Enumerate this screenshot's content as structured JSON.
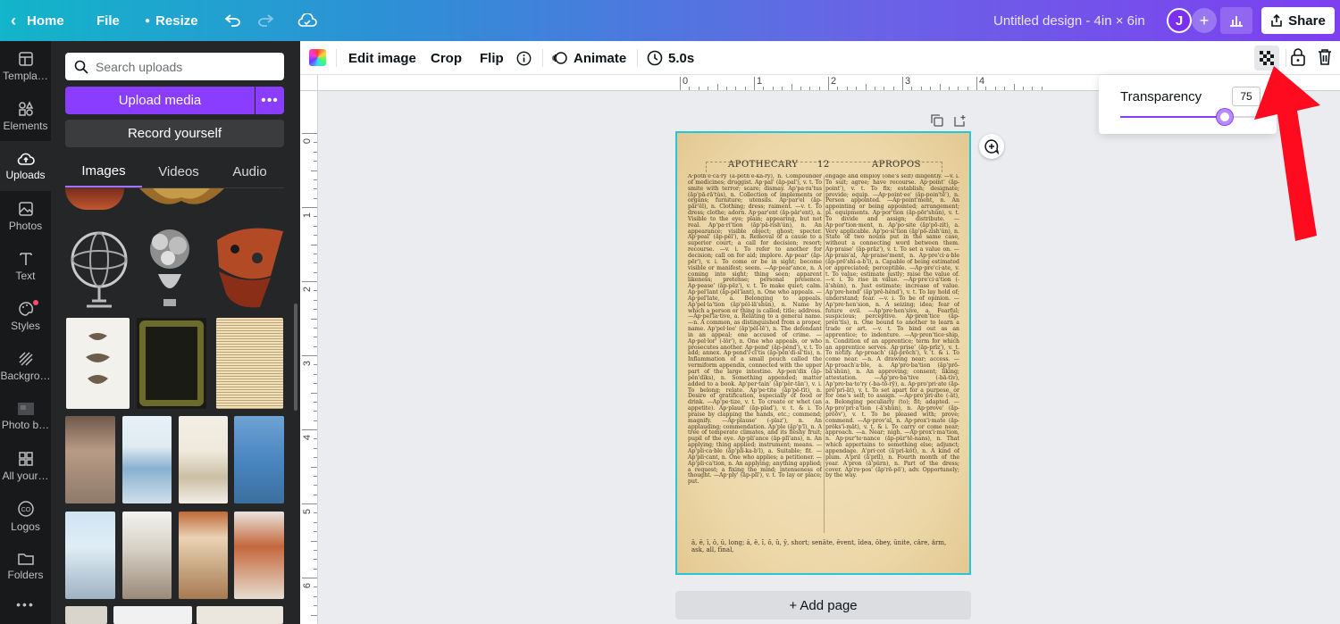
{
  "topbar": {
    "home": "Home",
    "file": "File",
    "resize": "Resize",
    "title": "Untitled design - 4in × 6in",
    "avatar_initial": "J",
    "share": "Share"
  },
  "rail": [
    {
      "label": "Templa…",
      "icon": "template-icon"
    },
    {
      "label": "Elements",
      "icon": "elements-icon"
    },
    {
      "label": "Uploads",
      "icon": "upload-cloud-icon",
      "active": true
    },
    {
      "label": "Photos",
      "icon": "photos-icon"
    },
    {
      "label": "Text",
      "icon": "text-icon"
    },
    {
      "label": "Styles",
      "icon": "styles-icon"
    },
    {
      "label": "Backgro…",
      "icon": "background-icon"
    },
    {
      "label": "Photo b…",
      "icon": "photo-background-icon"
    },
    {
      "label": "All your…",
      "icon": "all-your-designs-icon"
    },
    {
      "label": "Logos",
      "icon": "logos-icon"
    },
    {
      "label": "Folders",
      "icon": "folder-icon"
    }
  ],
  "panel": {
    "search_placeholder": "Search uploads",
    "upload_media": "Upload media",
    "more": "•••",
    "record": "Record yourself",
    "tabs": [
      "Images",
      "Videos",
      "Audio"
    ]
  },
  "context_toolbar": {
    "edit_image": "Edit image",
    "crop": "Crop",
    "flip": "Flip",
    "animate": "Animate",
    "duration": "5.0s"
  },
  "rulers": {
    "top": [
      "0",
      "1",
      "2",
      "3",
      "4"
    ],
    "left": [
      "0",
      "1",
      "2",
      "3",
      "4",
      "5",
      "6"
    ]
  },
  "dictionary": {
    "header_left": "APOTHECARY",
    "header_page": "12",
    "header_right": "APROPOS",
    "col_left": "A·poth'e·ca·ry (a-pŏth'ē-kā-rȳ), n. Compounder of medicines; druggist. Ap·pal' (ăp-pal'), v. t. To smite with terror; scare; dismay. Ap'pa·ra'tus (ăp'pā-rā'tŭs), n. Collection of implements or organs; furniture; utensils. Ap·par'el (ăp-păr'ĕl), n. Clothing; dress; raiment. —v. t. To dress; clothe; adorn. Ap·par'ent (ăp-pâr'ent), a. Visible to the eye; plain; appearing, but not real. Ap'pa·ri'tion (ăp'pā-rĭsh'ŭn), n. An appearance; visible object; ghost; specter. Ap·peal' (ăp-pēl'), n. Removal of a cause to a superior court; a call for decision; resort; recourse. —v. i. To refer to another for decision; call on for aid; implore. Ap·pear' (ăp-pēr'), v. i. To come or be in sight; become visible or manifest; seem. —Ap·pear'ance, n. A coming into sight; thing seen; apparent likeness; pretense; personal presence. Ap·pease' (ăp-pēz'), v. t. To make quiet; calm. Ap·pel'lant (ăp-pĕl'lant), n. One who appeals. —Ap·pel'late, a. Belonging to appeals. Ap'pel·la'tion (ăp'pĕl-lā'shŭn), n. Name by which a person or thing is called; title; address. —Ap·pel'la·tive, a. Relating to a general name. —n. A common, as distinguished from a proper, name. Ap'pel·lee' (ăp'pĕl-lē'), n. The defendant in an appeal; one accused of crime. —Ap·pel·lor' (-lôr'), n. One who appeals, or who prosecutes another. Ap·pend' (ăp-pĕnd'), v. t. To add; annex. Ap·pend'i·ci'tis (ăp-pĕn'dĭ-sī'tĭs), n. Inflammation of a small pouch called the vermiform appendix, connected with the upper part of the large intestine. Ap·pen'dix (ăp-pĕn'dĭks), n. Something appended; matter added to a book. Ap'per·tain' (ăp'pĕr-tān'), v. i. To belong; relate. Ap'pe·tite (ăp'pē-tīt), n. Desire of gratification, especially of food or drink. —Ap'pe·tize, v. t. To create or whet (an appetite). Ap·plaud' (ăp-plad'), v. t. & i. To praise by clapping the hands, etc.; commend; magnify. —Ap·plause' (-plaz'), n. An applauding; commendation. Ap'ple (ăp'p'l), n. A tree of temperate climates, and its fleshy fruit; pupil of the eye. Ap·pli'ance (ăp-plī'ans), n. An applying; thing applied; instrument; means. —Ap'pli·ca·ble (ăp'plĭ-ka-b'l), a. Suitable; fit. —Ap'pli·cant, n. One who applies; a petitioner. —Ap'pli·ca'tion, n. An applying; anything applied; a request; a fixing the mind; intenseness of thought. —Ap·ply' (ăp-plī'), v. t. To lay or place; put.",
    "col_right": "engage and employ (one's self) diligently. —v. i. To suit; agree; have recourse. Ap·point' (ăp-point'), v. t. To fix; establish; designate; provide; equip. —Ap·point·ee' (ăp-poin'tē'), n. Person appointed. —Ap·point'ment, n. An appointing or being appointed; arrangement; pl. equipments. Ap·por'tion (ăp-pōr'shŭn), v. t. To divide and assign; distribute. —Ap·por'tion·ment, n. Ap'po·site (ăp'pō-zĭt), a. Very applicable. Ap'po·si'tion (ăp'pō-zĭsh'ŭn), n. State of two nouns put in the same case, without a connecting word between them. Ap·praise' (ăp-prāz'), v. t. To set a value on. —Ap·prais'al, Ap·praise'ment, n. Ap·pre'ci·a·ble (ăp-prē'shĭ-a-b'l), a. Capable of being estimated or appreciated; perceptible. —Ap·pre'ci·ate, v. t. To value; estimate justly; raise the value of. —v. i. To rise in value. —Ap·pre'ci·a'tion (-ā'shŭn), n. Just estimate; increase of value. Ap'pre·hend' (ăp'prē-hĕnd'), v. t. To lay hold of; understand; fear. —v. i. To be of opinion. —Ap'pre·hen'sion, n. A seizing; idea; fear of future evil. —Ap'pre·hen'sive, a. Fearful; suspicious; perceptive. Ap·pren'tice (ăp-prĕn'tĭs), n. One bound to another to learn a trade or art. —v. t. To bind out as an apprentice; to indenture. —Ap·pren'tice·ship, n. Condition of an apprentice; term for which an apprentice serves. Ap·prise' (ăp-prīz'), v. t. To notify. Ap·proach' (ăp-prōch'), v. t. & i. To come near. —n. A drawing near; access. —Ap·proach'a·ble, a. Ap'pro·ba'tion (ăp'prō-bā'shŭn), n. An approving; consent; liking; attestation. —Ap'pro·ba'tive (-bā-tĭv), Ap'pro·ba·to'ry (-ba-tō-rȳ), a. Ap·pro'pri·ate (ăp-prō'prĭ-āt), v. t. To set apart for a purpose, or for one's self; to assign. —Ap·pro'pri·ate (-ât), a. Belonging peculiarly (to); fit; adapted. —Ap·pro'pri·a'tion (-ā'shŭn), n. Ap·prove' (ăp-prōōv'), v. t. To be pleased with; prove; commend. —Ap·prov'al, n. Ap·prox'i·mate (ăp-prŏks'ĭ-māt), v. t. & i. To carry or come near; approach. —a. Near; nigh. —Ap·prox'i·ma'tion, n. Ap·pur'te·nance (ăp-pûr'tē-nans), n. That which appertains to something else; adjunct; appendage. A'pri·cot (ā'prĭ-kŏt), n. A kind of plum. A'pril (ā'prĭl), n. Fourth month of the year. A'pron (ā'pŭrn), n. Part of the dress; cover. Ap'ro·pos' (ăp'rō-pō'), adv. Opportunely; by the way.",
    "footer": "ā, ē, ī, ō, ū, long; ă, ĕ, ĭ, ŏ, ŭ, ȳ, short; senāte, ēvent, ĭdea, ōbey, ūnite, câre, ärm, ask, all, fīnal,"
  },
  "canvas": {
    "add_page": "+ Add page"
  },
  "transparency": {
    "label": "Transparency",
    "value": "75",
    "level": 0.75
  },
  "colors": {
    "accent": "#8b3dff",
    "selection": "#25c6d6",
    "arrow": "#ff0b1f"
  }
}
